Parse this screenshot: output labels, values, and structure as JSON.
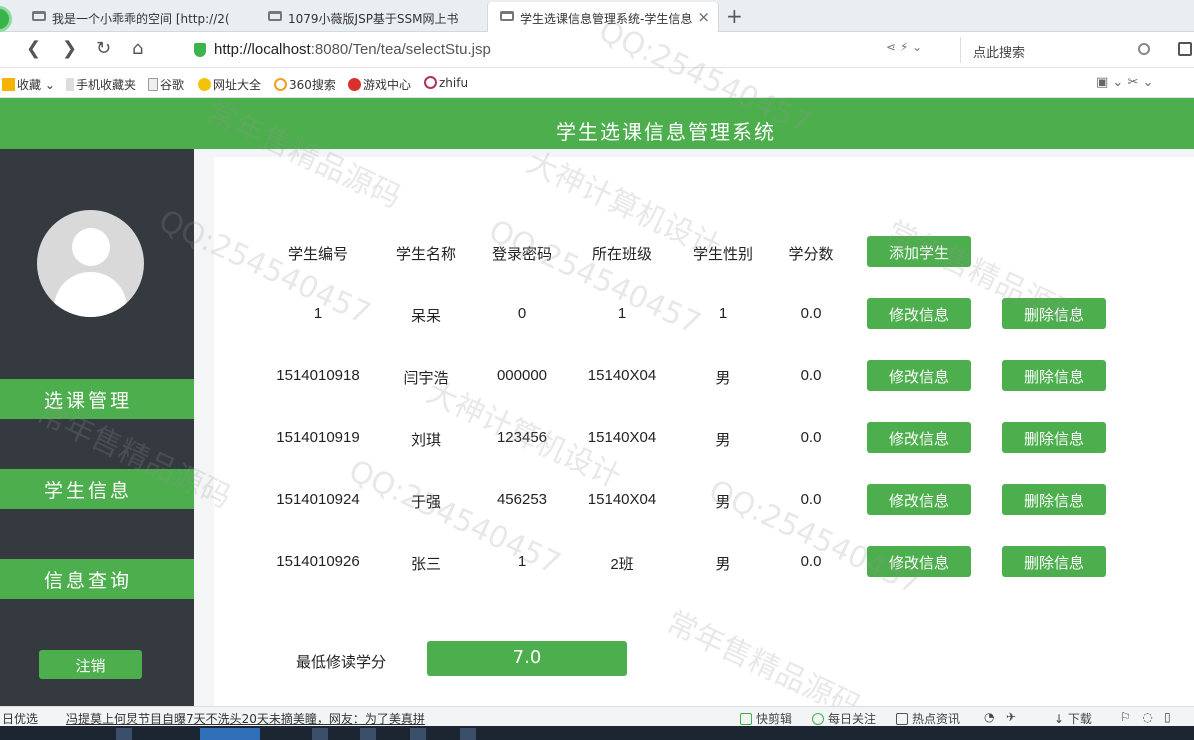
{
  "browser": {
    "tabs": [
      {
        "label": "我是一个小乖乖的空间 [http://2("
      },
      {
        "label": "1079小薇版JSP基于SSM网上书"
      },
      {
        "label": "学生选课信息管理系统-学生信息"
      }
    ],
    "new_tab": "+",
    "url_host": "http://localhost",
    "url_rest": ":8080/Ten/tea/selectStu.jsp",
    "search_placeholder": "点此搜索",
    "bookmarks": [
      "收藏",
      "手机收藏夹",
      "谷歌",
      "网址大全",
      "360搜索",
      "游戏中心",
      "zhifu"
    ]
  },
  "header": {
    "title": "学生选课信息管理系统"
  },
  "sidebar": {
    "menu": [
      "选课管理",
      "学生信息",
      "信息查询"
    ],
    "logout": "注销"
  },
  "table": {
    "headers": [
      "学生编号",
      "学生名称",
      "登录密码",
      "所在班级",
      "学生性别",
      "学分数"
    ],
    "add_button": "添加学生",
    "edit_button": "修改信息",
    "delete_button": "删除信息",
    "rows": [
      [
        "1",
        "呆呆",
        "0",
        "1",
        "1",
        "0.0"
      ],
      [
        "1514010918",
        "闫宇浩",
        "000000",
        "15140X04",
        "男",
        "0.0"
      ],
      [
        "1514010919",
        "刘琪",
        "123456",
        "15140X04",
        "男",
        "0.0"
      ],
      [
        "1514010924",
        "于强",
        "456253",
        "15140X04",
        "男",
        "0.0"
      ],
      [
        "1514010926",
        "张三",
        "1",
        "2班",
        "男",
        "0.0"
      ]
    ]
  },
  "min_credit": {
    "label": "最低修读学分",
    "value": "7.0"
  },
  "statusbar": {
    "left": "日优选",
    "news": "冯提莫上何炅节目自曝7天不洗头20天未摘美瞳，网友：为了美真拼",
    "items": [
      "快剪辑",
      "每日关注",
      "热点资讯",
      "下载"
    ]
  },
  "watermarks": [
    "QQ:254540457",
    "常年售精品源码",
    "大神计算机设计"
  ],
  "colors": {
    "accent": "#4cae4c",
    "sidebar": "#343a40"
  }
}
